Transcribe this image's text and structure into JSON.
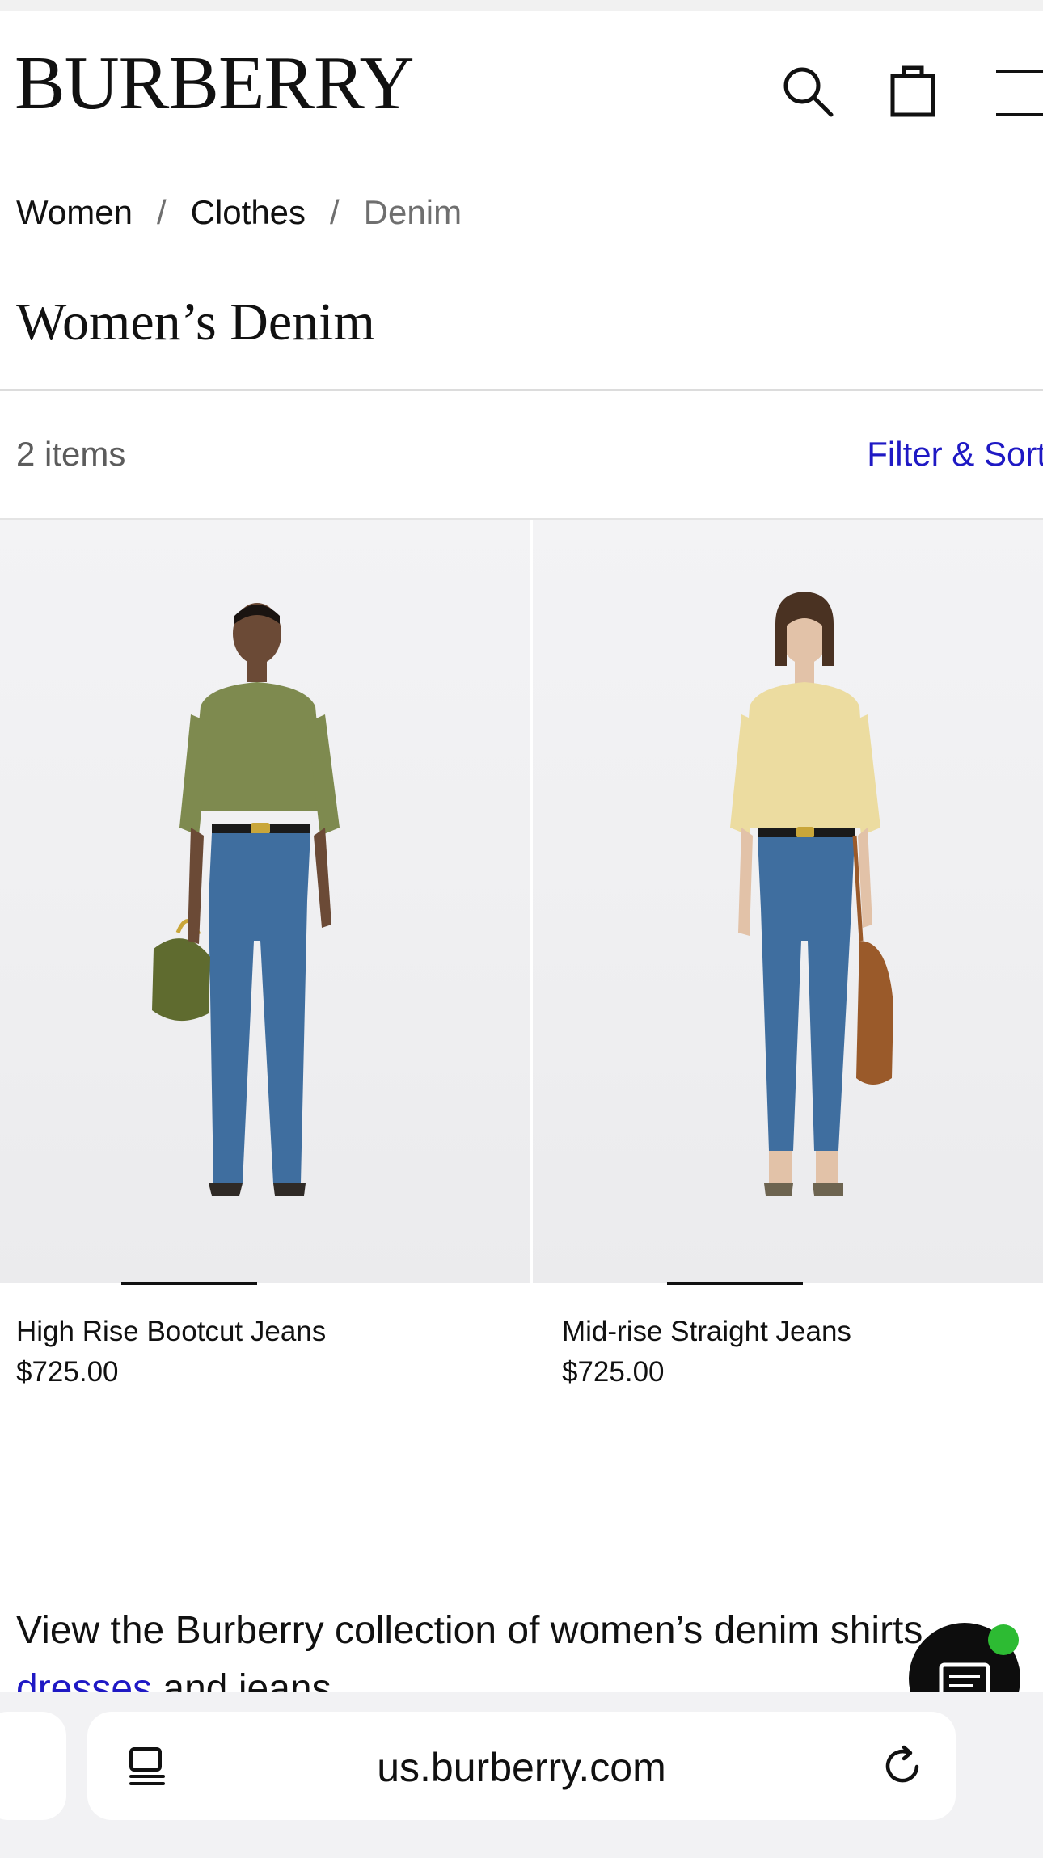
{
  "header": {
    "brand": "BURBERRY",
    "icons": [
      "search-icon",
      "shopping-bag-icon",
      "menu-icon"
    ]
  },
  "breadcrumb": {
    "items": [
      "Women",
      "Clothes",
      "Denim"
    ],
    "separator": "/"
  },
  "page": {
    "title": "Women’s Denim"
  },
  "toolbar": {
    "item_count": "2 items",
    "filter_sort_label": "Filter & Sort"
  },
  "products": [
    {
      "name": "High Rise Bootcut Jeans",
      "price": "$725.00",
      "shirt_color": "#7e8a4f",
      "bag_color": "#5f6b2f"
    },
    {
      "name": "Mid-rise Straight Jeans",
      "price": "$725.00",
      "shirt_color": "#ecdca0",
      "bag_color": "#9a5a2a"
    }
  ],
  "description": {
    "line1": "View the Burberry collection of women’s denim shirts,",
    "link": "dresses",
    "line2_rest": " and jeans."
  },
  "browser": {
    "url": "us.burberry.com",
    "icons": [
      "reader-icon",
      "reload-icon"
    ]
  },
  "colors": {
    "accent_link": "#1f19c4",
    "chat_status": "#2dbb33",
    "denim": "#3f6e9f"
  }
}
